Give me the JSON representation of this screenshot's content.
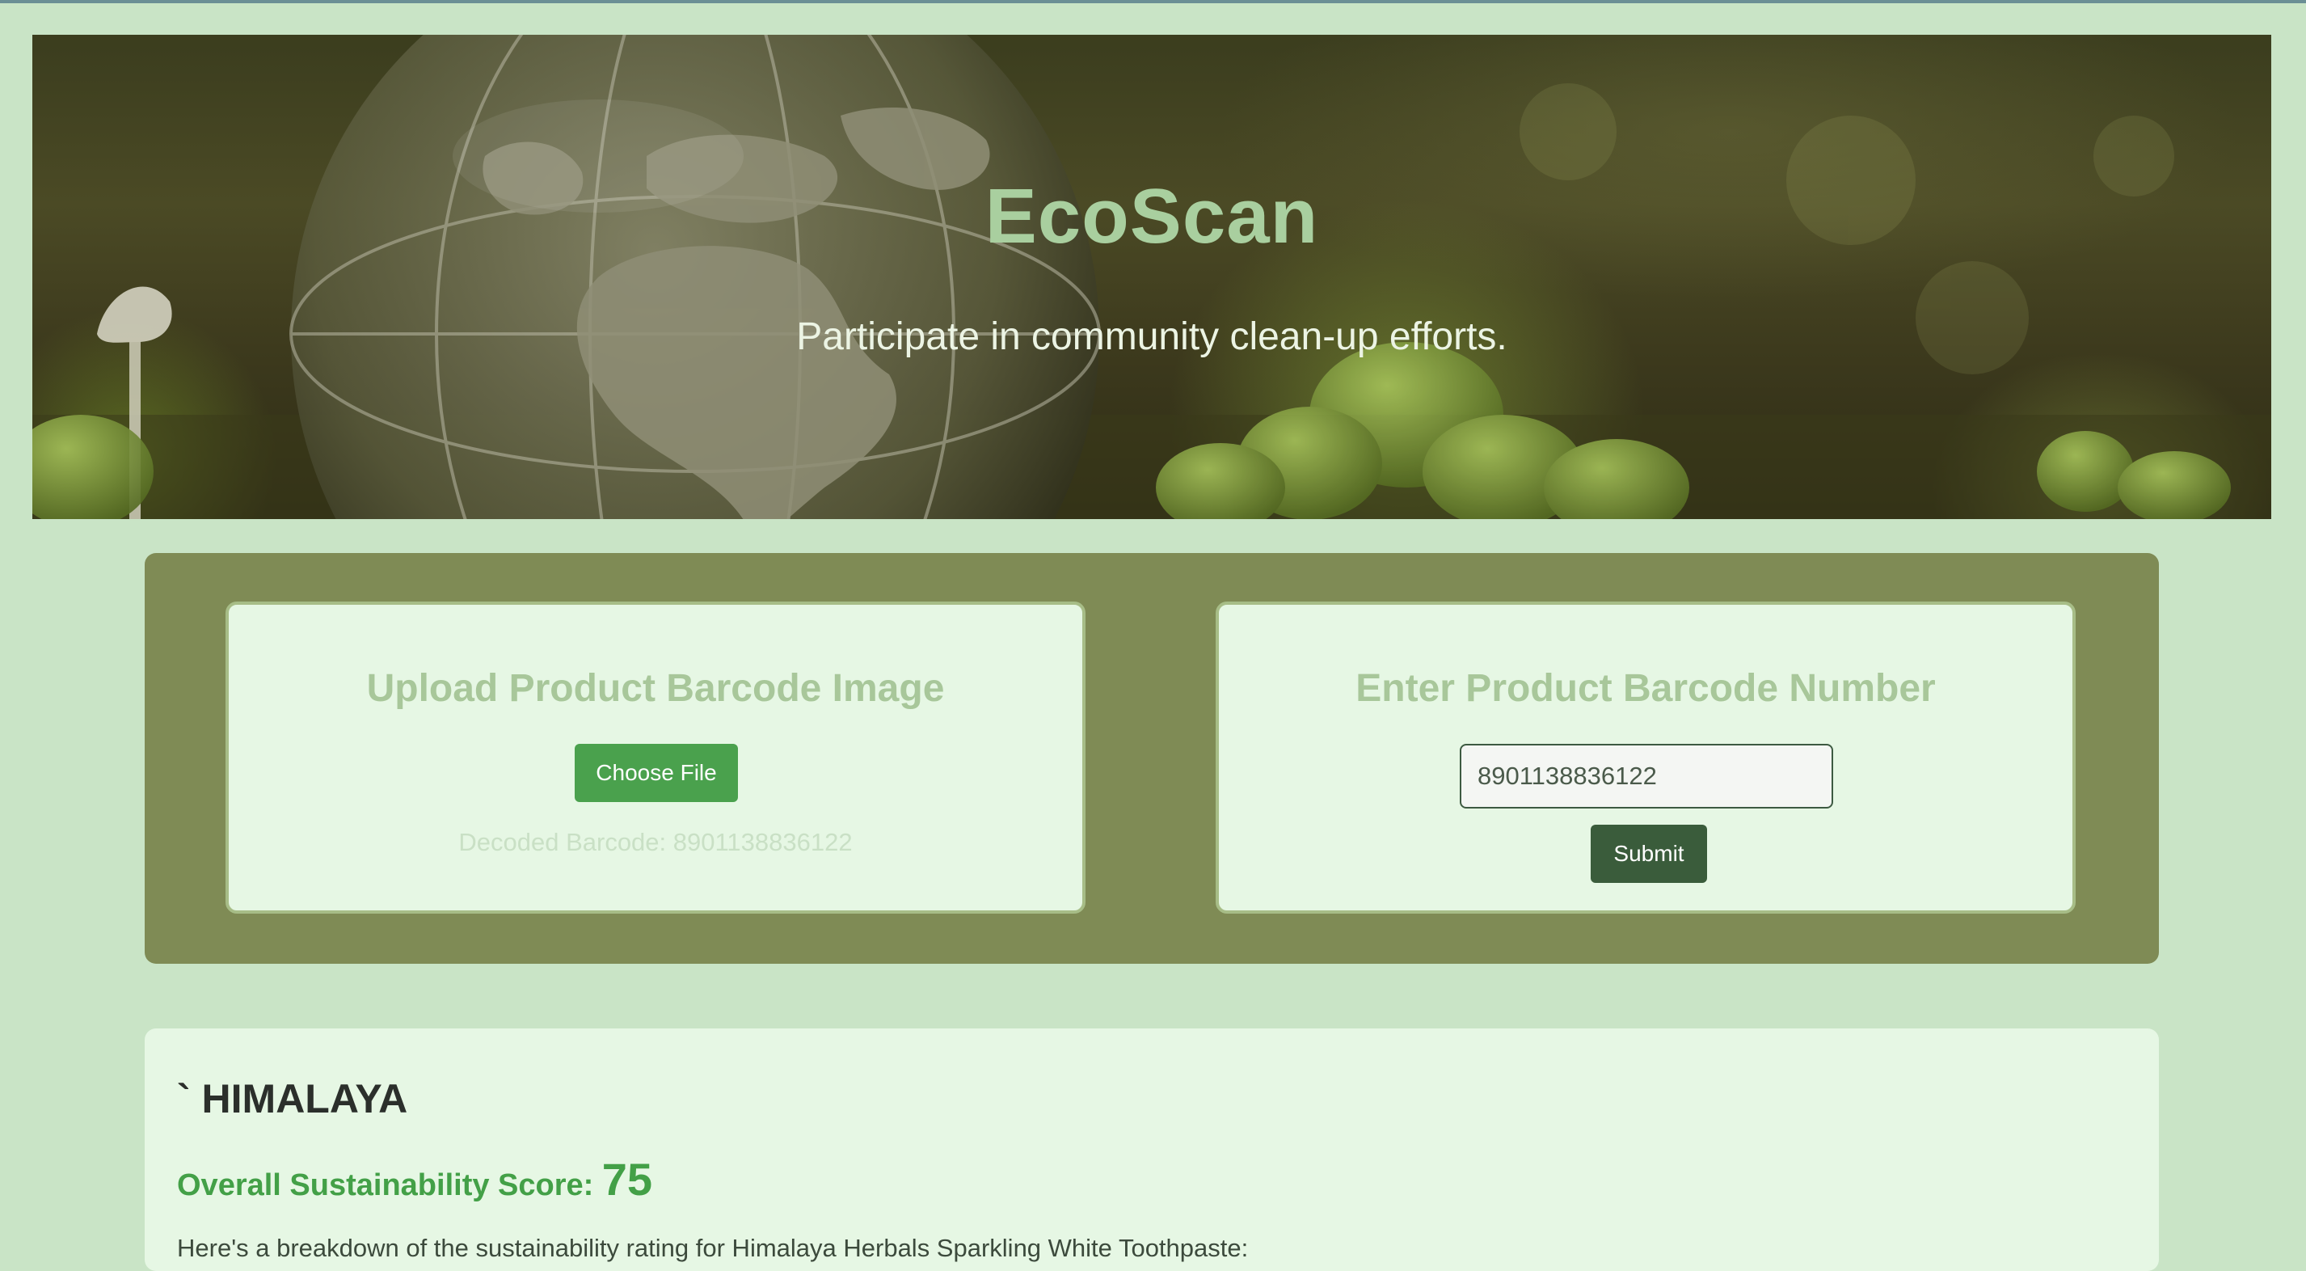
{
  "hero": {
    "title": "EcoScan",
    "subtitle": "Participate in community clean-up efforts."
  },
  "upload_card": {
    "title": "Upload Product Barcode Image",
    "button_label": "Choose File",
    "decoded_text": "Decoded Barcode: 8901138836122"
  },
  "entry_card": {
    "title": "Enter Product Barcode Number",
    "input_value": "8901138836122",
    "submit_label": "Submit"
  },
  "result": {
    "brand": "` HIMALAYA",
    "score_label": "Overall Sustainability Score:",
    "score_value": "75",
    "breakdown_text": "Here's a breakdown of the sustainability rating for Himalaya Herbals Sparkling White Toothpaste:"
  },
  "colors": {
    "page_background": "#c9e4c6",
    "panel": "#7f8b55",
    "card": "#e6f7e4",
    "primary_button": "#4aa14d",
    "submit_button": "#3a5c3b",
    "score_accent": "#43a047",
    "hero_title": "#a9cf9f"
  },
  "icons": {
    "hero_image": "crystal-globe-on-moss-image"
  }
}
